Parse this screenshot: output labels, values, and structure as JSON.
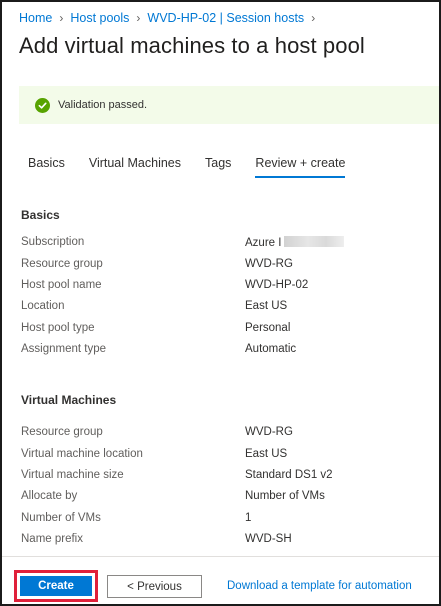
{
  "breadcrumb": {
    "items": [
      "Home",
      "Host pools",
      "WVD-HP-02 | Session hosts"
    ],
    "separator": ">"
  },
  "page": {
    "title": "Add virtual machines to a host pool"
  },
  "banner": {
    "text": "Validation passed.",
    "status_color": "#57a300",
    "background": "#f3fbe9"
  },
  "tabs": [
    {
      "label": "Basics",
      "active": false
    },
    {
      "label": "Virtual Machines",
      "active": false
    },
    {
      "label": "Tags",
      "active": false
    },
    {
      "label": "Review + create",
      "active": true
    }
  ],
  "basics": {
    "heading": "Basics",
    "rows": [
      {
        "label": "Subscription",
        "value": "Azure I"
      },
      {
        "label": "Resource group",
        "value": "WVD-RG"
      },
      {
        "label": "Host pool name",
        "value": "WVD-HP-02"
      },
      {
        "label": "Location",
        "value": "East US"
      },
      {
        "label": "Host pool type",
        "value": "Personal"
      },
      {
        "label": "Assignment type",
        "value": "Automatic"
      }
    ]
  },
  "vms": {
    "heading": "Virtual Machines",
    "rows": [
      {
        "label": "Resource group",
        "value": "WVD-RG"
      },
      {
        "label": "Virtual machine location",
        "value": "East US"
      },
      {
        "label": "Virtual machine size",
        "value": "Standard DS1 v2"
      },
      {
        "label": "Allocate by",
        "value": "Number of VMs"
      },
      {
        "label": "Number of VMs",
        "value": "1"
      },
      {
        "label": "Name prefix",
        "value": "WVD-SH"
      }
    ]
  },
  "footer": {
    "create_label": "Create",
    "previous_label": "< Previous",
    "download_label": "Download a template for automation",
    "accent": "#0078d4",
    "highlight": "#e0203a"
  }
}
